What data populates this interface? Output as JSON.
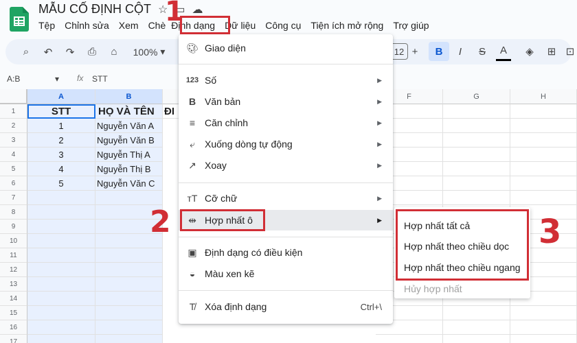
{
  "app": {
    "doc_title": "MẪU CỐ ĐỊNH CỘT"
  },
  "menubar": [
    "Tệp",
    "Chỉnh sửa",
    "Xem",
    "Chè",
    "Định dạng",
    "Dữ liệu",
    "Công cụ",
    "Tiện ích mở rộng",
    "Trợ giúp"
  ],
  "toolbar": {
    "zoom": "100%",
    "font_size": "12"
  },
  "formula_bar": {
    "name_box": "A:B",
    "fx_label": "fx",
    "value": "STT"
  },
  "sheet": {
    "columns": [
      "A",
      "B",
      "ĐI",
      "F",
      "G",
      "H"
    ],
    "rows": [
      "1",
      "2",
      "3",
      "4",
      "5",
      "6",
      "7",
      "8",
      "9",
      "10",
      "11",
      "12",
      "13",
      "14",
      "15",
      "16",
      "17"
    ],
    "header_row": [
      "STT",
      "HỌ VÀ TÊN",
      "ĐI"
    ],
    "data": [
      [
        "1",
        "Nguyễn Văn A"
      ],
      [
        "2",
        "Nguyễn Văn B"
      ],
      [
        "3",
        "Nguyễn Thị A"
      ],
      [
        "4",
        "Nguyễn Thị B"
      ],
      [
        "5",
        "Nguyễn Văn C"
      ]
    ]
  },
  "format_menu": {
    "items": [
      {
        "icon": "palette-icon",
        "label": "Giao diện"
      },
      {
        "icon": "number-icon",
        "glyph": "123",
        "label": "Số"
      },
      {
        "icon": "bold-text-icon",
        "glyph": "B",
        "label": "Văn bản"
      },
      {
        "icon": "align-icon",
        "label": "Căn chỉnh"
      },
      {
        "icon": "wrap-icon",
        "label": "Xuống dòng tự động"
      },
      {
        "icon": "rotate-icon",
        "label": "Xoay"
      },
      {
        "icon": "font-size-icon",
        "label": "Cỡ chữ"
      },
      {
        "icon": "merge-icon",
        "label": "Hợp nhất ô"
      },
      {
        "icon": "conditional-format-icon",
        "label": "Định dạng có điều kiện"
      },
      {
        "icon": "alternating-colors-icon",
        "label": "Màu xen kẽ"
      },
      {
        "icon": "clear-format-icon",
        "label": "Xóa định dạng",
        "shortcut": "Ctrl+\\"
      }
    ]
  },
  "merge_submenu": {
    "items": [
      "Hợp nhất tất cả",
      "Hợp nhất theo chiều dọc",
      "Hợp nhất theo chiều ngang",
      "Hủy hợp nhất"
    ]
  },
  "annotations": {
    "step1": "1",
    "step2": "2",
    "step3": "3",
    "color": "#d12e35"
  }
}
